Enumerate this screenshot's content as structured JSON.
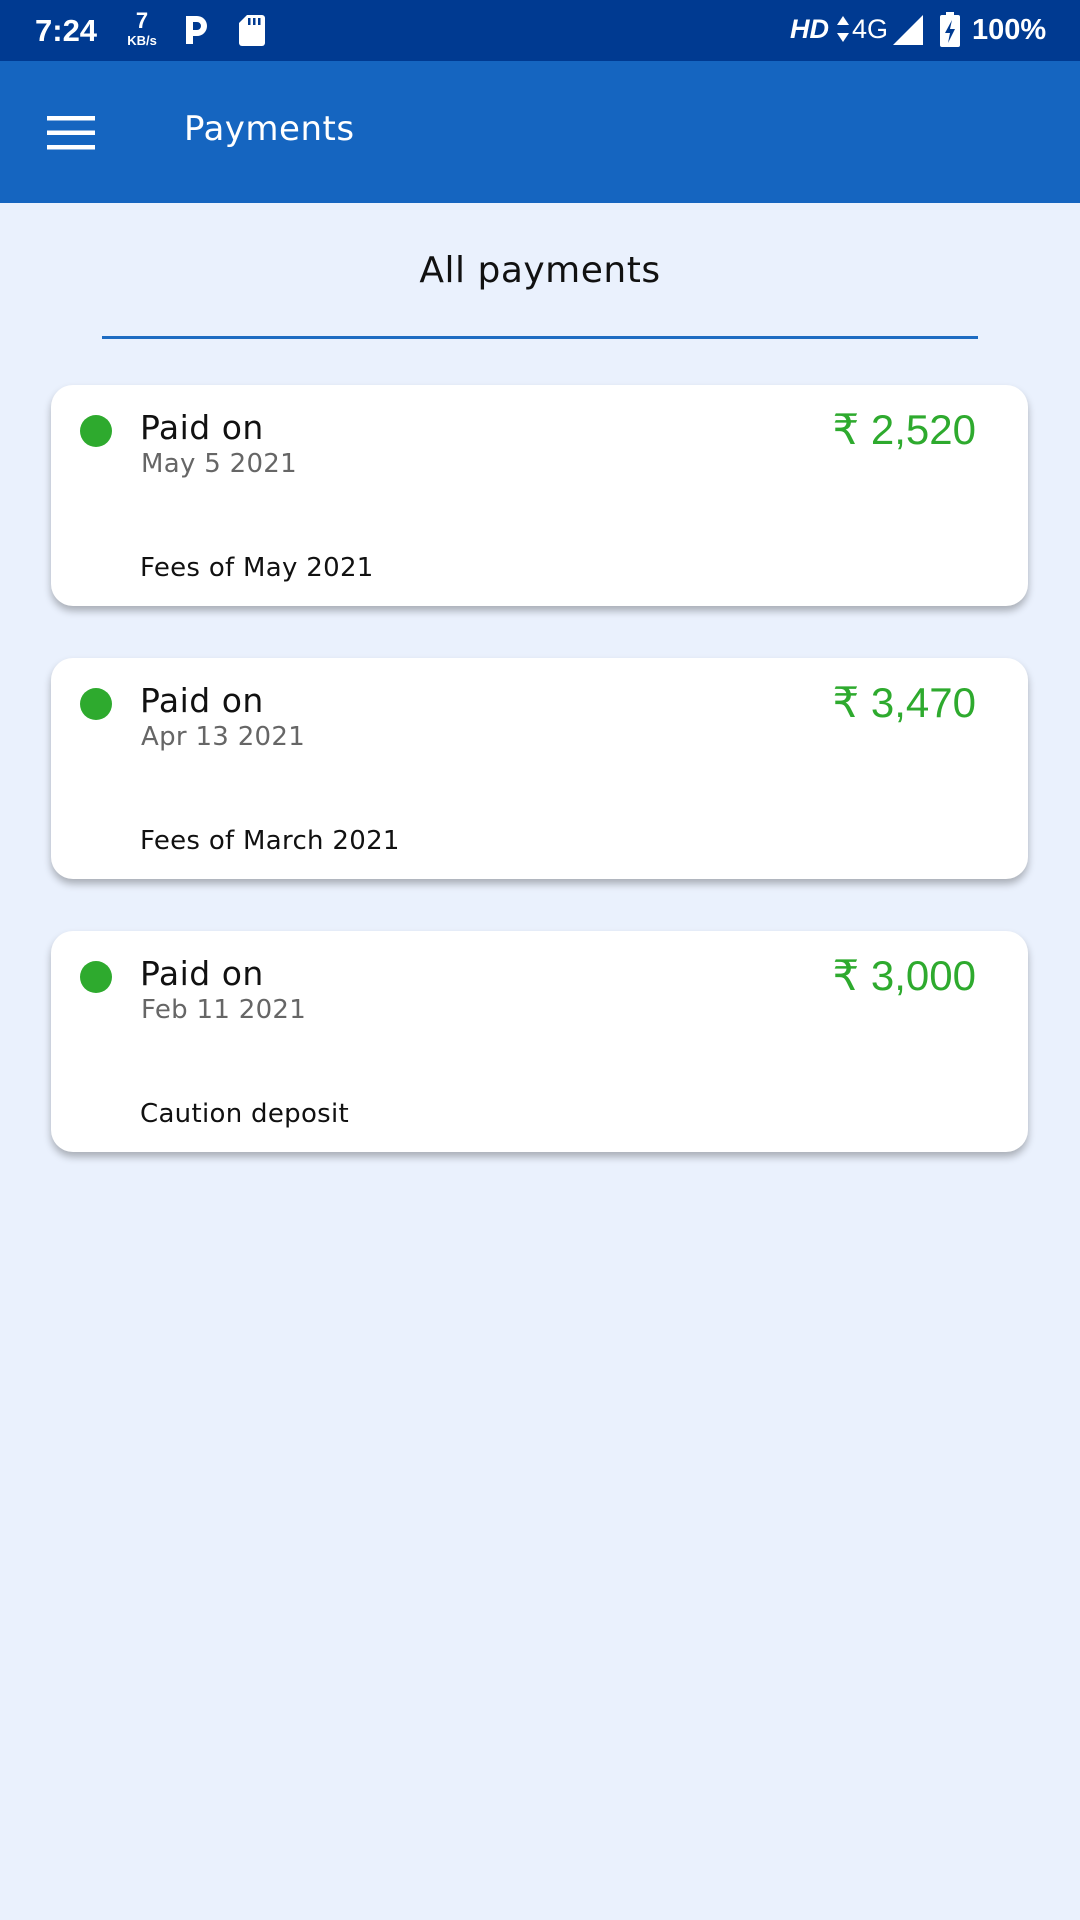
{
  "status_bar": {
    "time": "7:24",
    "net_speed": "7",
    "net_speed_unit": "KB/s",
    "hd": "HD",
    "network": "4G",
    "battery": "100%",
    "icons": [
      "parking-icon",
      "sd-card-icon",
      "data-arrows-icon",
      "signal-icon",
      "battery-charging-icon"
    ]
  },
  "app_bar": {
    "title": "Payments",
    "menu_icon": "menu-icon"
  },
  "section": {
    "title": "All payments"
  },
  "payments": [
    {
      "status_label": "Paid on",
      "date": "May 5 2021",
      "amount": "₹ 2,520",
      "description": "Fees of May 2021"
    },
    {
      "status_label": "Paid on",
      "date": "Apr 13 2021",
      "amount": "₹ 3,470",
      "description": "Fees of March 2021"
    },
    {
      "status_label": "Paid on",
      "date": "Feb 11 2021",
      "amount": "₹ 3,000",
      "description": "Caution deposit"
    }
  ],
  "colors": {
    "status_bar": "#003a91",
    "app_bar": "#1565c0",
    "background": "#eaf1fd",
    "paid": "#2eaa2e",
    "divider": "#1e6cc2"
  }
}
